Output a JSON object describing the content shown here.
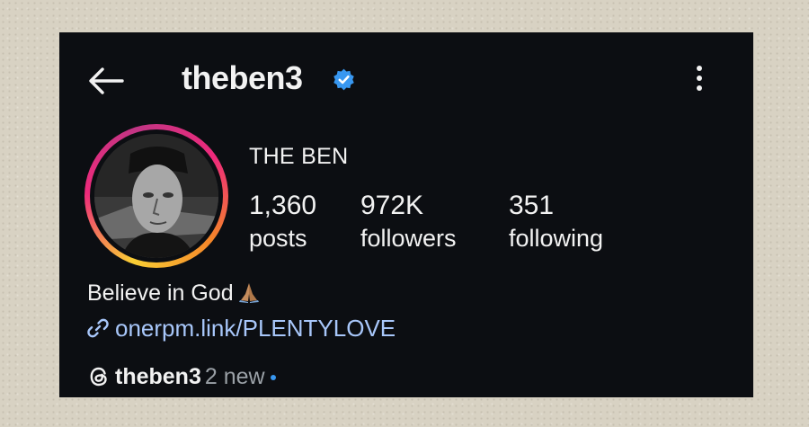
{
  "header": {
    "username": "theben3",
    "verified": true,
    "back_icon": "arrow-left-icon",
    "more_icon": "more-vertical-icon"
  },
  "profile": {
    "display_name": "THE BEN",
    "avatar_description": "black-and-white profile photo",
    "stats": [
      {
        "value": "1,360",
        "label": "posts"
      },
      {
        "value": "972K",
        "label": "followers"
      },
      {
        "value": "351",
        "label": "following"
      }
    ],
    "bio": "Believe in God",
    "bio_emoji": "folded-hands-icon",
    "link": "onerpm.link/PLENTYLOVE"
  },
  "threads": {
    "icon": "threads-icon",
    "username": "theben3",
    "badge": "2 new"
  },
  "colors": {
    "background": "#0c0e12",
    "text": "#f2f2f2",
    "link": "#a8c7fa",
    "verified": "#3897f0",
    "muted": "#9aa0a6"
  }
}
